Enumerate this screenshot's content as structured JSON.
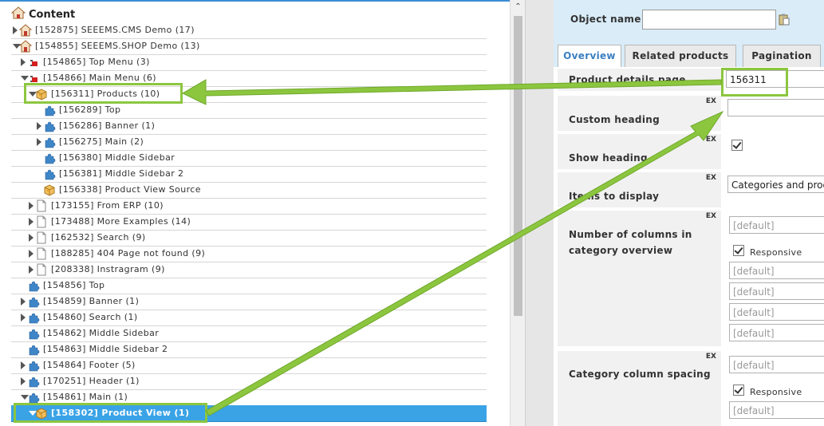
{
  "tree": {
    "title": "Content",
    "rows": [
      {
        "label": "[152875] SEEEMS.CMS Demo (17)",
        "icon": "house-icon",
        "arrow": "right",
        "indent": 0
      },
      {
        "label": "[154855] SEEEMS.SHOP Demo (13)",
        "icon": "house-icon",
        "arrow": "down",
        "indent": 0
      },
      {
        "label": "[154865] Top Menu (3)",
        "icon": "menu-icon",
        "arrow": "right",
        "indent": 1
      },
      {
        "label": "[154866] Main Menu (6)",
        "icon": "menu-icon",
        "arrow": "down",
        "indent": 1
      },
      {
        "label": "[156311] Products (10)",
        "icon": "box-icon",
        "arrow": "down",
        "indent": 2
      },
      {
        "label": "[156289] Top",
        "icon": "puzzle-icon",
        "arrow": "none",
        "indent": 3
      },
      {
        "label": "[156286] Banner (1)",
        "icon": "puzzle-icon",
        "arrow": "right",
        "indent": 3
      },
      {
        "label": "[156275] Main (2)",
        "icon": "puzzle-icon",
        "arrow": "right",
        "indent": 3
      },
      {
        "label": "[156380] Middle Sidebar",
        "icon": "puzzle-icon",
        "arrow": "none",
        "indent": 3
      },
      {
        "label": "[156381] Middle Sidebar 2",
        "icon": "puzzle-icon",
        "arrow": "none",
        "indent": 3
      },
      {
        "label": "[156338] Product View Source",
        "icon": "box-icon",
        "arrow": "none",
        "indent": 3
      },
      {
        "label": "[173155] From ERP (10)",
        "icon": "page-icon",
        "arrow": "right",
        "indent": 2
      },
      {
        "label": "[173488] More Examples (14)",
        "icon": "page-icon",
        "arrow": "right",
        "indent": 2
      },
      {
        "label": "[162532] Search (9)",
        "icon": "page-icon",
        "arrow": "right",
        "indent": 2
      },
      {
        "label": "[188285] 404 Page not found (9)",
        "icon": "page-icon",
        "arrow": "right",
        "indent": 2
      },
      {
        "label": "[208338] Instragram (9)",
        "icon": "page-icon",
        "arrow": "right",
        "indent": 2
      },
      {
        "label": "[154856] Top",
        "icon": "puzzle-icon",
        "arrow": "none",
        "indent": 1
      },
      {
        "label": "[154859] Banner (1)",
        "icon": "puzzle-icon",
        "arrow": "right",
        "indent": 1
      },
      {
        "label": "[154860] Search (1)",
        "icon": "puzzle-icon",
        "arrow": "right",
        "indent": 1
      },
      {
        "label": "[154862] Middle Sidebar",
        "icon": "puzzle-icon",
        "arrow": "none",
        "indent": 1
      },
      {
        "label": "[154863] Middle Sidebar 2",
        "icon": "puzzle-icon",
        "arrow": "none",
        "indent": 1
      },
      {
        "label": "[154864] Footer (5)",
        "icon": "puzzle-icon",
        "arrow": "right",
        "indent": 1
      },
      {
        "label": "[170251] Header (1)",
        "icon": "puzzle-icon",
        "arrow": "right",
        "indent": 1
      },
      {
        "label": "[154861] Main (1)",
        "icon": "puzzle-icon",
        "arrow": "down",
        "indent": 1
      },
      {
        "label": "[158302] Product View (1)",
        "icon": "box-icon",
        "arrow": "down",
        "indent": 2,
        "selected": true
      }
    ]
  },
  "properties": {
    "object_name_label": "Object name",
    "object_name_value": "",
    "tabs": [
      "Overview",
      "Related products",
      "Pagination"
    ],
    "active_tab": "Overview",
    "ex_label": "EX",
    "fields": {
      "product_details_page": {
        "label": "Product details page",
        "value": "156311"
      },
      "custom_heading": {
        "label": "Custom heading",
        "value": ""
      },
      "show_heading": {
        "label": "Show heading",
        "checked": true
      },
      "items_to_display": {
        "label": "Items to display",
        "value": "Categories and products"
      },
      "columns_in_category": {
        "label": "Number of columns in category overview",
        "placeholder": "[default]",
        "responsive_label": "Responsive",
        "responsive_checked": true
      },
      "category_column_spacing": {
        "label": "Category column spacing",
        "placeholder": "[default]",
        "responsive_label": "Responsive",
        "responsive_checked": true
      }
    }
  },
  "colors": {
    "accent": "#3aa3e6",
    "highlight": "#8cc63f",
    "panel": "#d9ecf8"
  }
}
